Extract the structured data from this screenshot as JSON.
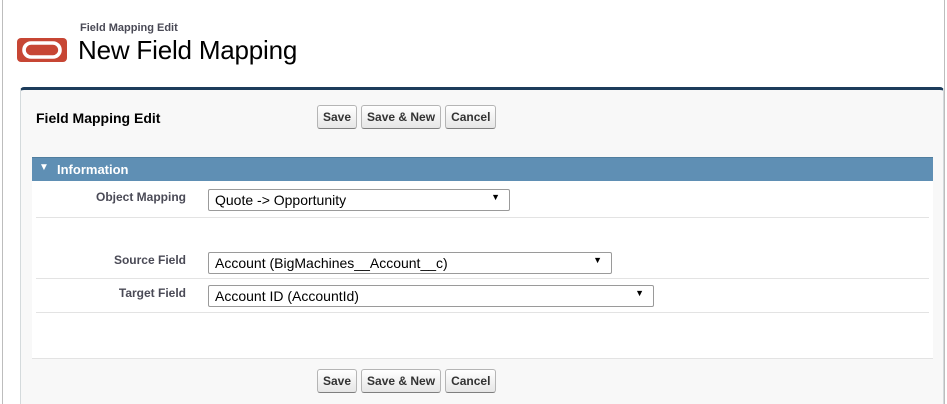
{
  "header": {
    "subtitle": "Field Mapping Edit",
    "title": "New Field Mapping"
  },
  "panel": {
    "title": "Field Mapping Edit",
    "buttons": {
      "save": "Save",
      "save_new": "Save & New",
      "cancel": "Cancel"
    }
  },
  "section": {
    "title": "Information"
  },
  "fields": {
    "object_mapping": {
      "label": "Object Mapping",
      "value": "Quote -> Opportunity"
    },
    "source_field": {
      "label": "Source Field",
      "value": "Account (BigMachines__Account__c)"
    },
    "target_field": {
      "label": "Target Field",
      "value": "Account ID (AccountId)"
    }
  },
  "icons": {
    "logo": "oracle-logo-icon",
    "section_toggle": "triangle-down-icon",
    "dropdown": "dropdown-arrow-icon"
  },
  "colors": {
    "brand": "#c74634",
    "header_border": "#1d3c5b",
    "section_bar": "#5f8fb4"
  }
}
